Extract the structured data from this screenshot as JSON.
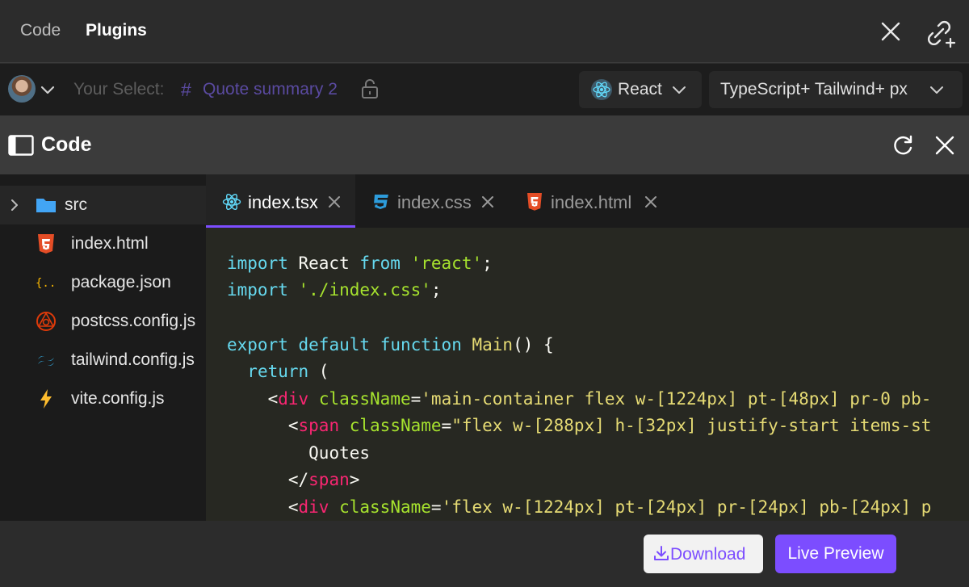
{
  "colors": {
    "accent": "#7c4dff",
    "selection_text": "#5a4aa0",
    "editor_bg": "#272822",
    "keyword": "#66d9ef",
    "string": "#a6e22e",
    "tag": "#f92672"
  },
  "header": {
    "tabs": [
      {
        "label": "Code",
        "active": false
      },
      {
        "label": "Plugins",
        "active": true
      }
    ],
    "icons": [
      "close-icon",
      "link-add-icon"
    ]
  },
  "selection_bar": {
    "label": "Your Select:",
    "hash": "#",
    "layer_name": "Quote summary 2",
    "framework": {
      "label": "React",
      "icon": "react-icon"
    },
    "language": {
      "label": "TypeScript+ Tailwind+ px"
    }
  },
  "panel": {
    "title": "Code",
    "icons": [
      "sidebar-toggle-icon",
      "refresh-icon",
      "close-icon"
    ]
  },
  "file_tree": {
    "items": [
      {
        "label": "src",
        "icon": "folder-icon"
      },
      {
        "label": "index.html",
        "icon": "html5-icon"
      },
      {
        "label": "package.json",
        "icon": "json-icon"
      },
      {
        "label": "postcss.config.js",
        "icon": "postcss-icon"
      },
      {
        "label": "tailwind.config.js",
        "icon": "tailwind-icon"
      },
      {
        "label": "vite.config.js",
        "icon": "vite-icon"
      }
    ]
  },
  "editor": {
    "tabs": [
      {
        "label": "index.tsx",
        "icon": "react-icon",
        "active": true
      },
      {
        "label": "index.css",
        "icon": "css3-icon",
        "active": false
      },
      {
        "label": "index.html",
        "icon": "html5-icon",
        "active": false
      }
    ],
    "code_lines": [
      "import React from 'react';",
      "import './index.css';",
      "",
      "export default function Main() {",
      "  return (",
      "    <div className='main-container flex w-[1224px] pt-[48px] pr-0 pb-",
      "      <span className=\"flex w-[288px] h-[32px] justify-start items-st",
      "        Quotes",
      "      </span>",
      "      <div className='flex w-[1224px] pt-[24px] pr-[24px] pb-[24px] p"
    ],
    "tokens": {
      "l0": [
        "import",
        " React ",
        "from",
        " ",
        "'react'",
        ";"
      ],
      "l1": [
        "import",
        " ",
        "'./index.css'",
        ";"
      ],
      "l3": [
        "export",
        " ",
        "default",
        " ",
        "function",
        " ",
        "Main",
        "() {"
      ],
      "l4": [
        "return",
        " ("
      ],
      "l5": [
        "<",
        "div",
        " ",
        "className",
        "=",
        "'main-container flex w-[1224px] pt-[48px] pr-0 pb-"
      ],
      "l6": [
        "<",
        "span",
        " ",
        "className",
        "=",
        "\"flex w-[288px] h-[32px] justify-start items-st"
      ],
      "l7": [
        "Quotes"
      ],
      "l8": [
        "</",
        "span",
        ">"
      ],
      "l9": [
        "<",
        "div",
        " ",
        "className",
        "=",
        "'flex w-[1224px] pt-[24px] pr-[24px] pb-[24px] p"
      ]
    }
  },
  "footer": {
    "download_label": "Download",
    "live_preview_label": "Live Preview"
  }
}
